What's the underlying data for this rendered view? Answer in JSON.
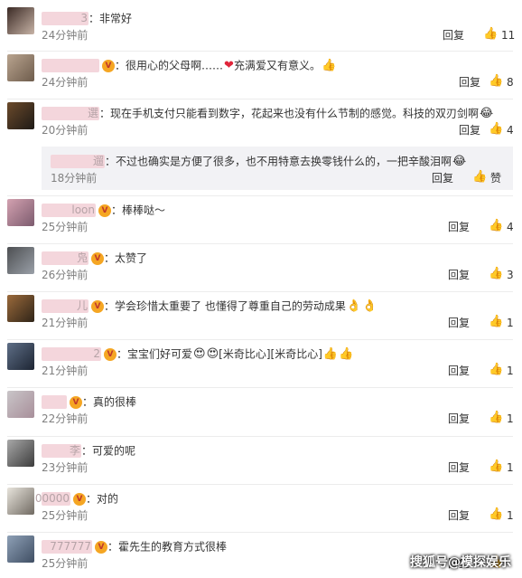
{
  "icons": {
    "like": "thumbs-up-icon",
    "vip": "vip-badge-icon"
  },
  "colors": {
    "name_mask": "#f4d6dc",
    "heart": "#e0253a",
    "vip": "#f5a623",
    "sub_bg": "#f2f2f5"
  },
  "comments": [
    {
      "name_tail": "3",
      "vip": false,
      "text": "非常好",
      "emoji": [],
      "time": "24分钟前",
      "reply": "回复",
      "likes": "11"
    },
    {
      "name_tail": "",
      "vip": true,
      "text": "很用心的父母啊……",
      "mid_emoji": "❤",
      "text2": "充满爱又有意义。",
      "emoji": [
        "👍"
      ],
      "time": "24分钟前",
      "reply": "回复",
      "likes": "8"
    },
    {
      "name_tail": "選",
      "vip": false,
      "text": "现在手机支付只能看到数字，花起来也没有什么节制的感觉。科技的双刃剑啊",
      "emoji": [
        "😂"
      ],
      "time": "20分钟前",
      "reply": "回复",
      "likes": "4"
    },
    {
      "name_tail": "遛",
      "vip": false,
      "text": "不过也确实是方便了很多，也不用特意去换零钱什么的，一把辛酸泪啊",
      "emoji": [
        "😂"
      ],
      "time": "18分钟前",
      "reply": "回复",
      "likes": "赞"
    },
    {
      "name_tail": "loon",
      "vip": true,
      "text": "棒棒哒～",
      "emoji": [],
      "time": "25分钟前",
      "reply": "回复",
      "likes": "4"
    },
    {
      "name_tail": "凫",
      "vip": true,
      "text": "太赞了",
      "emoji": [],
      "time": "26分钟前",
      "reply": "回复",
      "likes": "3"
    },
    {
      "name_tail": "儿",
      "vip": true,
      "text": "学会珍惜太重要了 也懂得了尊重自己的劳动成果",
      "emoji": [
        "👌",
        "👌"
      ],
      "time": "21分钟前",
      "reply": "回复",
      "likes": "1"
    },
    {
      "name_tail": "2",
      "vip": true,
      "text": "宝宝们好可爱",
      "emoji": [
        "😍",
        "😍"
      ],
      "text2": "[米奇比心][米奇比心]",
      "emoji2": [
        "👍",
        "👍"
      ],
      "time": "21分钟前",
      "reply": "回复",
      "likes": "1"
    },
    {
      "name_tail": "",
      "vip": true,
      "text": "真的很棒",
      "emoji": [],
      "time": "22分钟前",
      "reply": "回复",
      "likes": "1"
    },
    {
      "name_tail": "李",
      "vip": false,
      "text": "可爱的呢",
      "emoji": [],
      "time": "23分钟前",
      "reply": "回复",
      "likes": "1"
    },
    {
      "name_tail": "00000",
      "vip": true,
      "text": "对的",
      "emoji": [],
      "time": "25分钟前",
      "reply": "回复",
      "likes": "1"
    },
    {
      "name_tail": "777777",
      "vip": true,
      "text": "霍先生的教育方式很棒",
      "emoji": [],
      "time": "25分钟前",
      "reply": "回复",
      "likes": ""
    }
  ],
  "watermark": "搜狐号@模探娱乐"
}
